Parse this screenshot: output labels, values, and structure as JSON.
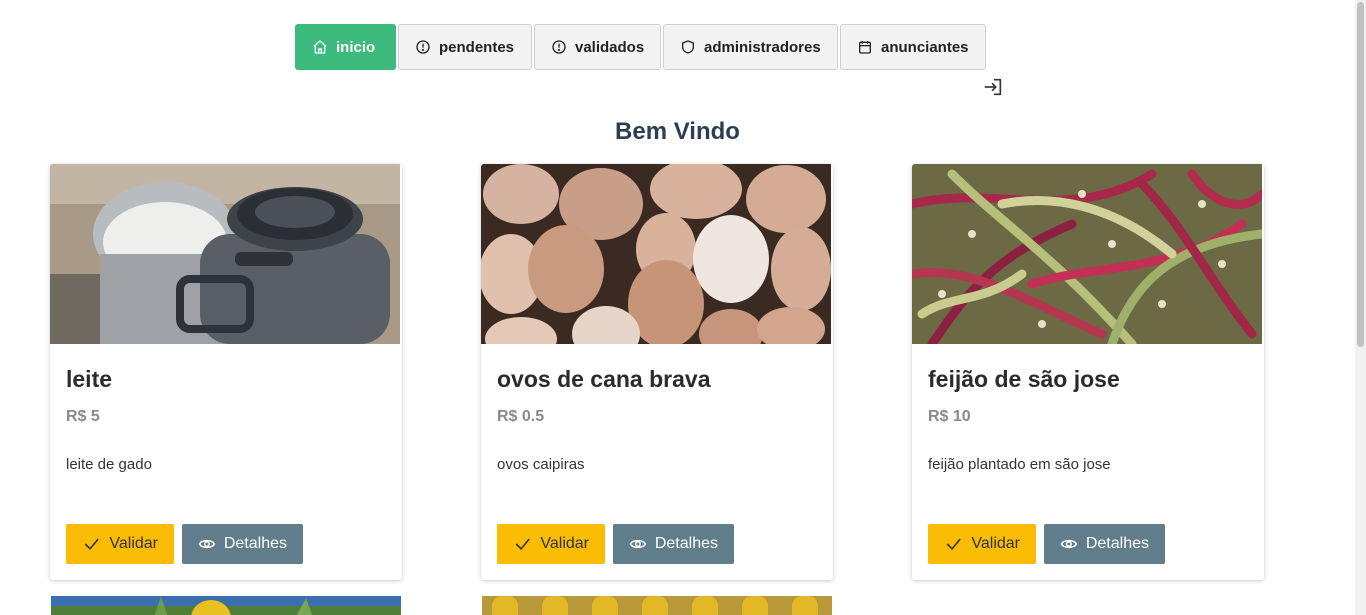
{
  "nav": {
    "tabs": [
      {
        "label": "inicio",
        "icon": "home-icon",
        "active": true
      },
      {
        "label": "pendentes",
        "icon": "alert-circle-icon",
        "active": false
      },
      {
        "label": "validados",
        "icon": "alert-circle-icon",
        "active": false
      },
      {
        "label": "administradores",
        "icon": "shield-icon",
        "active": false
      },
      {
        "label": "anunciantes",
        "icon": "calendar-icon",
        "active": false
      }
    ],
    "logout_icon": "logout-icon"
  },
  "page": {
    "title": "Bem Vindo"
  },
  "products": [
    {
      "name": "leite",
      "price": "R$ 5",
      "description": "leite de gado",
      "image": "milk-cans-photo",
      "validate_label": "Validar",
      "details_label": "Detalhes"
    },
    {
      "name": "ovos de cana brava",
      "price": "R$ 0.5",
      "description": "ovos caipiras",
      "image": "eggs-photo",
      "validate_label": "Validar",
      "details_label": "Detalhes"
    },
    {
      "name": "feijão de são jose",
      "price": "R$ 10",
      "description": "feijão plantado em são jose",
      "image": "beans-photo",
      "validate_label": "Validar",
      "details_label": "Detalhes"
    }
  ],
  "partial_cards": [
    {
      "image": "corn-photo"
    },
    {
      "image": "corn-photo"
    }
  ],
  "colors": {
    "active_tab": "#3dbb7d",
    "validate_button": "#fbbc05",
    "details_button": "#607d8b",
    "title": "#2c3e50"
  }
}
